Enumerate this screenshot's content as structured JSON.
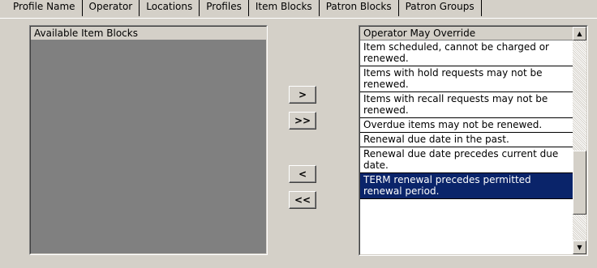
{
  "tabs": [
    {
      "label": "Profile Name"
    },
    {
      "label": "Operator"
    },
    {
      "label": "Locations"
    },
    {
      "label": "Profiles"
    },
    {
      "label": "Item Blocks",
      "active": true
    },
    {
      "label": "Patron Blocks"
    },
    {
      "label": "Patron Groups"
    }
  ],
  "available_list": {
    "header": "Available Item Blocks",
    "items": []
  },
  "buttons": {
    "add_one": ">",
    "add_all": ">>",
    "remove_one": "<",
    "remove_all": "<<"
  },
  "override_list": {
    "header": "Operator May Override",
    "items": [
      "Item scheduled, cannot be charged or renewed.",
      "Items with hold requests may not be renewed.",
      "Items with recall requests may not be renewed.",
      "Overdue items may not be renewed.",
      "Renewal due date in the past.",
      "Renewal due date precedes current due date.",
      "TERM renewal precedes permitted renewal period."
    ],
    "selected_index": 6
  },
  "scrollbar": {
    "up_icon": "▲",
    "down_icon": "▼"
  }
}
